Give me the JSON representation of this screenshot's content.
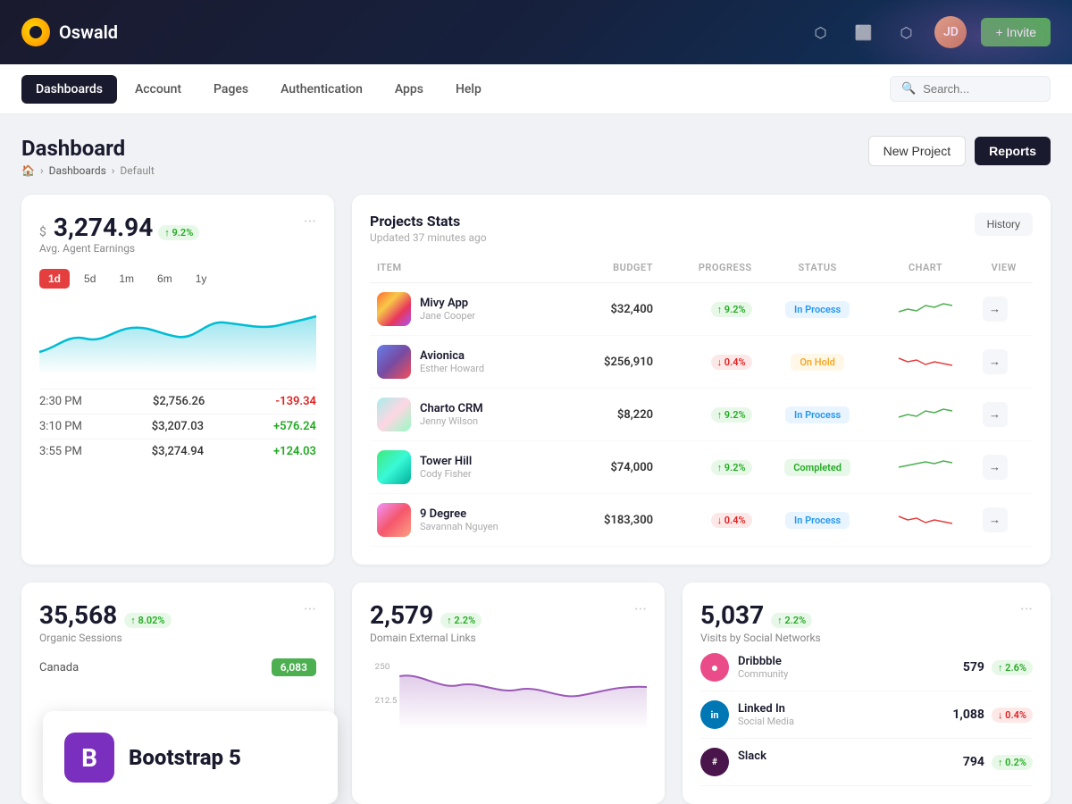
{
  "app": {
    "logo_title": "Oswald",
    "invite_label": "+ Invite"
  },
  "topbar_icons": [
    "mask-icon",
    "monitor-icon",
    "share-icon"
  ],
  "mainnav": {
    "items": [
      {
        "label": "Dashboards",
        "active": true
      },
      {
        "label": "Account",
        "active": false
      },
      {
        "label": "Pages",
        "active": false
      },
      {
        "label": "Authentication",
        "active": false
      },
      {
        "label": "Apps",
        "active": false
      },
      {
        "label": "Help",
        "active": false
      }
    ],
    "search_placeholder": "Search..."
  },
  "page": {
    "title": "Dashboard",
    "breadcrumb": [
      "home-icon",
      "Dashboards",
      "Default"
    ],
    "new_project_label": "New Project",
    "reports_label": "Reports"
  },
  "earnings_card": {
    "currency": "$",
    "amount": "3,274.94",
    "badge": "↑ 9.2%",
    "label": "Avg. Agent Earnings",
    "time_filters": [
      "1d",
      "5d",
      "1m",
      "6m",
      "1y"
    ],
    "active_filter": "1d",
    "rows": [
      {
        "time": "2:30 PM",
        "amount": "$2,756.26",
        "change": "-139.34",
        "positive": false
      },
      {
        "time": "3:10 PM",
        "amount": "$3,207.03",
        "change": "+576.24",
        "positive": true
      },
      {
        "time": "3:55 PM",
        "amount": "$3,274.94",
        "change": "+124.03",
        "positive": true
      }
    ]
  },
  "projects_card": {
    "title": "Projects Stats",
    "subtitle": "Updated 37 minutes ago",
    "history_label": "History",
    "columns": [
      "ITEM",
      "BUDGET",
      "PROGRESS",
      "STATUS",
      "CHART",
      "VIEW"
    ],
    "rows": [
      {
        "name": "Mivy App",
        "owner": "Jane Cooper",
        "budget": "$32,400",
        "progress": "↑ 9.2%",
        "progress_up": true,
        "status": "In Process",
        "status_type": "inprocess",
        "chart_color": "green"
      },
      {
        "name": "Avionica",
        "owner": "Esther Howard",
        "budget": "$256,910",
        "progress": "↓ 0.4%",
        "progress_up": false,
        "status": "On Hold",
        "status_type": "onhold",
        "chart_color": "red"
      },
      {
        "name": "Charto CRM",
        "owner": "Jenny Wilson",
        "budget": "$8,220",
        "progress": "↑ 9.2%",
        "progress_up": true,
        "status": "In Process",
        "status_type": "inprocess",
        "chart_color": "green"
      },
      {
        "name": "Tower Hill",
        "owner": "Cody Fisher",
        "budget": "$74,000",
        "progress": "↑ 9.2%",
        "progress_up": true,
        "status": "Completed",
        "status_type": "completed",
        "chart_color": "green"
      },
      {
        "name": "9 Degree",
        "owner": "Savannah Nguyen",
        "budget": "$183,300",
        "progress": "↓ 0.4%",
        "progress_up": false,
        "status": "In Process",
        "status_type": "inprocess",
        "chart_color": "red"
      }
    ]
  },
  "organic_card": {
    "amount": "35,568",
    "badge": "↑ 8.02%",
    "label": "Organic Sessions",
    "canada_label": "Canada",
    "canada_value": "6,083"
  },
  "domain_card": {
    "amount": "2,579",
    "badge": "↑ 2.2%",
    "label": "Domain External Links"
  },
  "social_card": {
    "amount": "5,037",
    "badge": "↑ 2.2%",
    "label": "Visits by Social Networks",
    "networks": [
      {
        "name": "Dribbble",
        "type": "Community",
        "count": "579",
        "badge": "↑ 2.6%",
        "up": true,
        "color": "#ea4c89"
      },
      {
        "name": "Linked In",
        "type": "Social Media",
        "count": "1,088",
        "badge": "↓ 0.4%",
        "up": false,
        "color": "#0077b5"
      },
      {
        "name": "Slack",
        "type": "",
        "count": "794",
        "badge": "↑ 0.2%",
        "up": true,
        "color": "#4a154b"
      }
    ]
  },
  "bootstrap": {
    "icon_label": "B",
    "title": "Bootstrap 5"
  }
}
